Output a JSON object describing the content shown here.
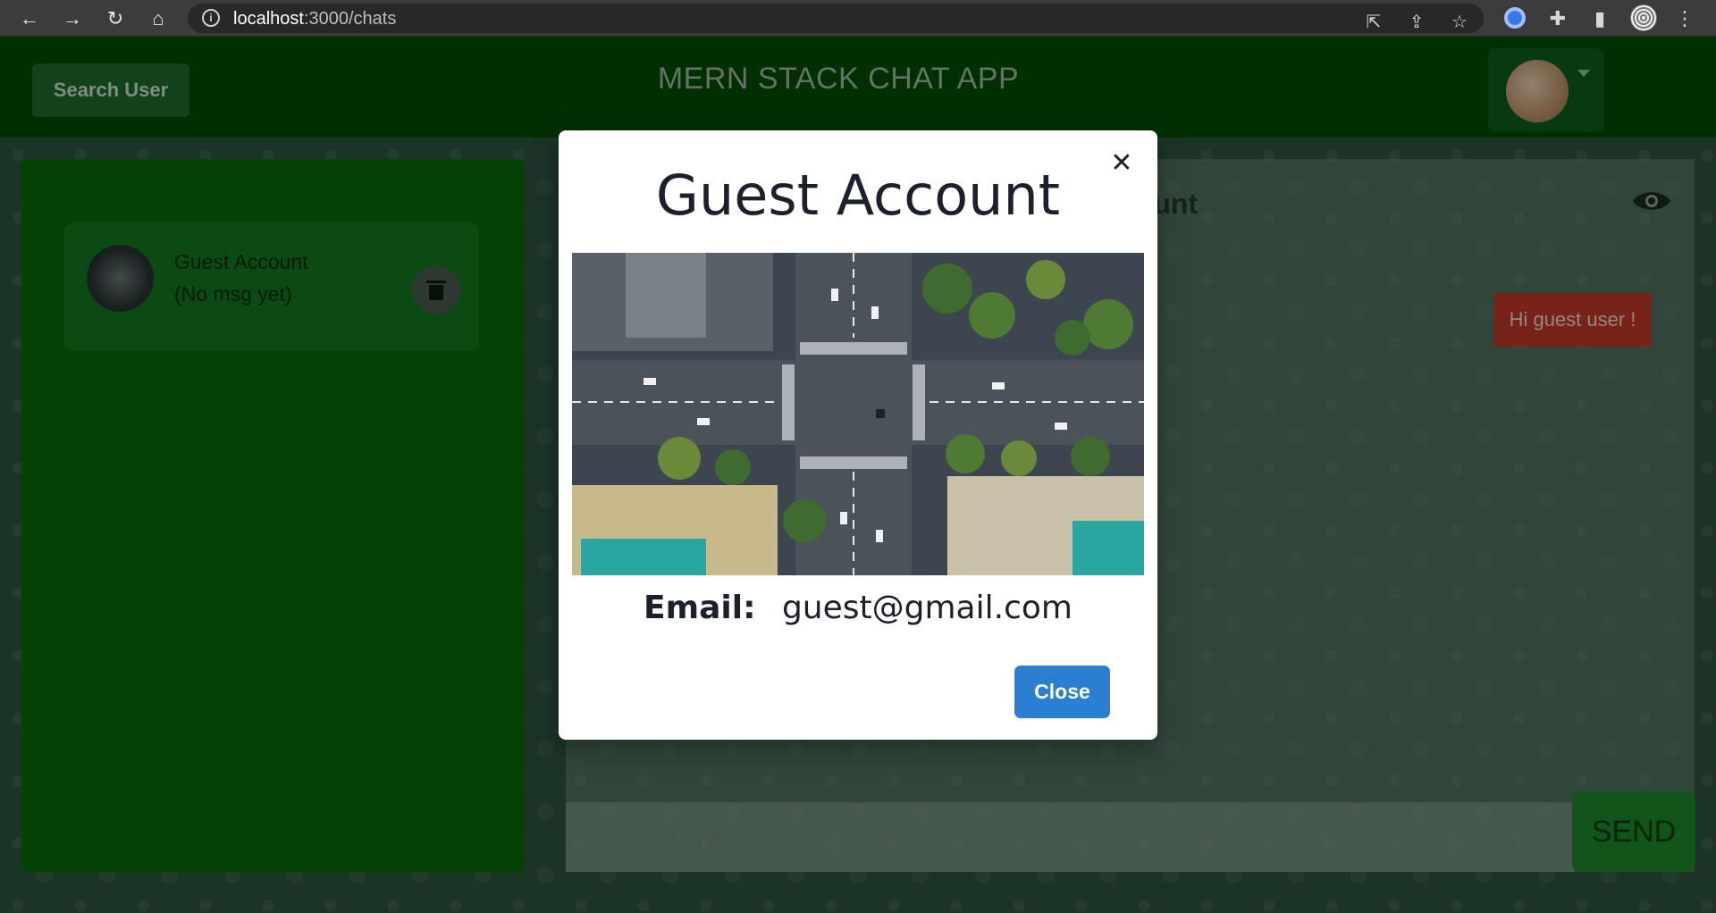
{
  "browser": {
    "url_host": "localhost",
    "url_path": ":3000/chats"
  },
  "header": {
    "search_button_label": "Search User",
    "app_title": "MERN STACK CHAT APP"
  },
  "chat_list": {
    "items": [
      {
        "name": "Guest Account",
        "preview": "(No msg yet)"
      }
    ]
  },
  "chat": {
    "header_name_partial": "count",
    "messages": [
      {
        "text": "Hi guest user !"
      }
    ],
    "input_placeholder": "Type a message..",
    "send_label": "SEND"
  },
  "modal": {
    "title": "Guest Account",
    "email_label": "Email:",
    "email_value": "guest@gmail.com",
    "close_label": "Close",
    "close_x": "✕"
  },
  "colors": {
    "header_bg": "#004d00",
    "chat_list_bg": "#0b6b0b",
    "message_bubble": "#c0392b",
    "close_button": "#2b7fd1"
  }
}
